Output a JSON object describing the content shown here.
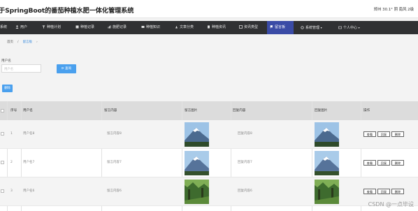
{
  "header": {
    "title": "于SpringBoot的番茄种植水肥一体化管理系统",
    "weather": "郑州 30.1° 阴 南风 2级"
  },
  "nav": {
    "items": [
      {
        "label": "系统",
        "icon": "home-icon"
      },
      {
        "label": "用户",
        "icon": "user-icon"
      },
      {
        "label": "种植计划",
        "icon": "plan-icon"
      },
      {
        "label": "种植记录",
        "icon": "record-icon"
      },
      {
        "label": "施肥记录",
        "icon": "fertilize-icon"
      },
      {
        "label": "种植知识",
        "icon": "book-icon"
      },
      {
        "label": "文章分类",
        "icon": "category-icon"
      },
      {
        "label": "种植资讯",
        "icon": "news-icon"
      },
      {
        "label": "资讯类型",
        "icon": "type-icon"
      },
      {
        "label": "留言板",
        "icon": "flag-icon"
      },
      {
        "label": "系统管理",
        "icon": "gear-icon"
      },
      {
        "label": "个人中心",
        "icon": "person-icon"
      }
    ],
    "active": "留言板"
  },
  "breadcrumb": {
    "home": "首页",
    "current": "留言板",
    "sep": "/",
    "arrow": "›"
  },
  "search": {
    "label": "用户名",
    "placeholder": "用户名",
    "button": "查询",
    "delete_button": "删除"
  },
  "table": {
    "headers": [
      "序号",
      "用户名",
      "留言内容",
      "留言图片",
      "回复内容",
      "回复图片",
      "操作"
    ],
    "rows": [
      {
        "index": "1",
        "user": "用户名8",
        "content": "留言内容8",
        "reply": "回复内容8",
        "pic": "snow-mountain",
        "reply_pic": "snow-mountain"
      },
      {
        "index": "2",
        "user": "用户名7",
        "content": "留言内容7",
        "reply": "回复内容7",
        "pic": "snow-mountain",
        "reply_pic": "snow-mountain"
      },
      {
        "index": "3",
        "user": "用户名6",
        "content": "留言内容6",
        "reply": "回复内容6",
        "pic": "forest",
        "reply_pic": "forest"
      }
    ],
    "actions": [
      "查看",
      "回复",
      "删除"
    ]
  },
  "watermark": "CSDN @一点毕设",
  "colors": {
    "nav_bg": "#303133",
    "active_bg": "#3a4ba6",
    "primary": "#4aa0ee",
    "header_row": "#dcdcdc"
  }
}
